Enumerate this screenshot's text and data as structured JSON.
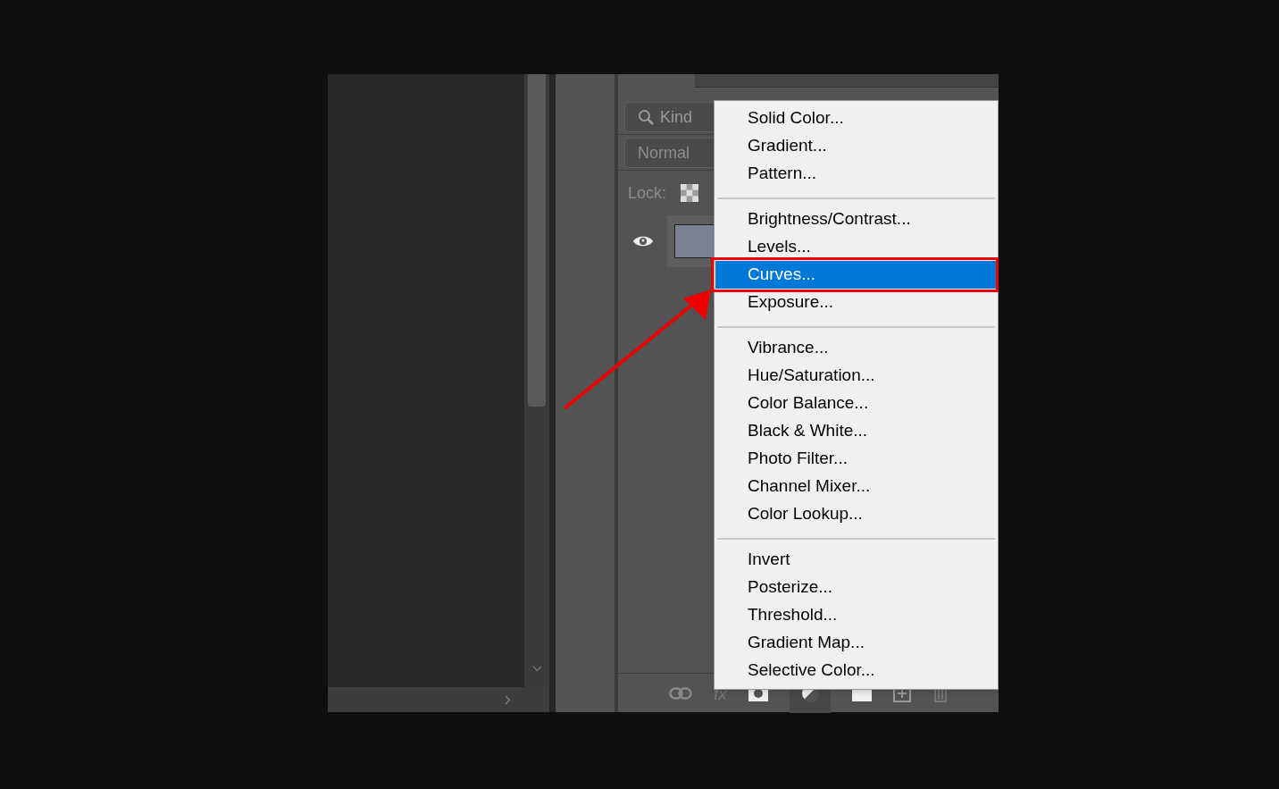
{
  "filter": {
    "placeholder": "Kind"
  },
  "blend_mode": {
    "value": "Normal"
  },
  "lock": {
    "label": "Lock:"
  },
  "layer": {
    "visible": true
  },
  "bottom_bar": {
    "fx_label": "fx"
  },
  "menu": {
    "sections": [
      [
        {
          "label": "Solid Color...",
          "selected": false
        },
        {
          "label": "Gradient...",
          "selected": false
        },
        {
          "label": "Pattern...",
          "selected": false
        }
      ],
      [
        {
          "label": "Brightness/Contrast...",
          "selected": false
        },
        {
          "label": "Levels...",
          "selected": false
        },
        {
          "label": "Curves...",
          "selected": true
        },
        {
          "label": "Exposure...",
          "selected": false
        }
      ],
      [
        {
          "label": "Vibrance...",
          "selected": false
        },
        {
          "label": "Hue/Saturation...",
          "selected": false
        },
        {
          "label": "Color Balance...",
          "selected": false
        },
        {
          "label": "Black & White...",
          "selected": false
        },
        {
          "label": "Photo Filter...",
          "selected": false
        },
        {
          "label": "Channel Mixer...",
          "selected": false
        },
        {
          "label": "Color Lookup...",
          "selected": false
        }
      ],
      [
        {
          "label": "Invert",
          "selected": false
        },
        {
          "label": "Posterize...",
          "selected": false
        },
        {
          "label": "Threshold...",
          "selected": false
        },
        {
          "label": "Gradient Map...",
          "selected": false
        },
        {
          "label": "Selective Color...",
          "selected": false
        }
      ]
    ]
  }
}
